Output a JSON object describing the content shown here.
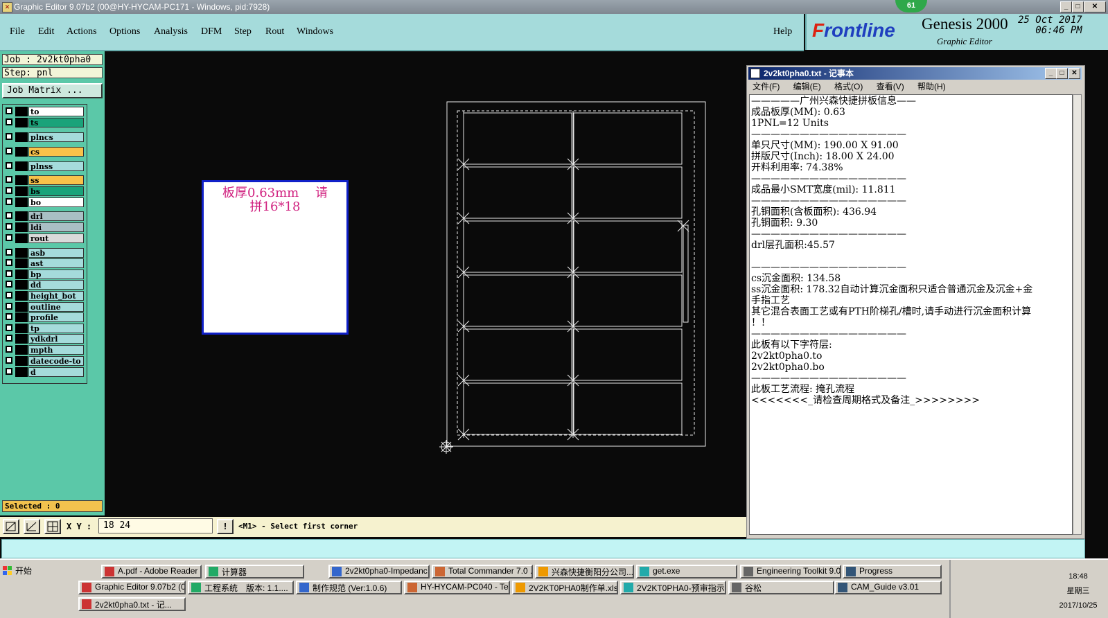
{
  "window": {
    "title": "Graphic Editor 9.07b2 (00@HY-HYCAM-PC171 - Windows, pid:7928)",
    "badge": "61"
  },
  "menu": [
    "File",
    "Edit",
    "Actions",
    "Options",
    "Analysis",
    "DFM",
    "Step",
    "Rout",
    "Windows"
  ],
  "help": "Help",
  "brand": {
    "logo_a": "F",
    "logo_b": "rontline",
    "product": "Genesis 2000",
    "subtitle": "Graphic Editor",
    "date": "25 Oct 2017",
    "time": "06:46 PM"
  },
  "job": {
    "job_label": "Job : 2v2kt0pha0",
    "step_label": "Step: pnl",
    "matrix_button": "Job Matrix ..."
  },
  "layers": [
    {
      "name": "to",
      "color": "#ffffff"
    },
    {
      "name": "ts",
      "color": "#1aa37a"
    },
    {
      "name": "plncs",
      "color": "#a5dbdb"
    },
    {
      "name": "cs",
      "color": "#f9c24a"
    },
    {
      "name": "plnss",
      "color": "#a5dbdb"
    },
    {
      "name": "ss",
      "color": "#f9c24a"
    },
    {
      "name": "bs",
      "color": "#1aa37a"
    },
    {
      "name": "bo",
      "color": "#ffffff"
    },
    {
      "name": "drl",
      "color": "#a9bfc4"
    },
    {
      "name": "ldi",
      "color": "#a9bfc4"
    },
    {
      "name": "rout",
      "color": "#dadada"
    },
    {
      "name": "asb",
      "color": "#a5dbdb"
    },
    {
      "name": "ast",
      "color": "#a5dbdb"
    },
    {
      "name": "bp",
      "color": "#a5dbdb"
    },
    {
      "name": "dd",
      "color": "#a5dbdb"
    },
    {
      "name": "height_bot",
      "color": "#a5dbdb"
    },
    {
      "name": "outline",
      "color": "#a5dbdb"
    },
    {
      "name": "profile",
      "color": "#a5dbdb"
    },
    {
      "name": "tp",
      "color": "#a5dbdb"
    },
    {
      "name": "ydkdrl",
      "color": "#a5dbdb"
    },
    {
      "name": "mpth",
      "color": "#a5dbdb"
    },
    {
      "name": "datecode-to",
      "color": "#a5dbdb"
    },
    {
      "name": "d",
      "color": "#a5dbdb"
    }
  ],
  "selected": "Selected : 0",
  "toolbar": {
    "xy_label": "X Y :",
    "xy_value": "18 24",
    "warn": "!",
    "message": "<M1> - Select first corner"
  },
  "note": {
    "line1": "板厚0.63mm　 请",
    "line2": "拼16*18"
  },
  "notepad": {
    "title": "2v2kt0pha0.txt - 记事本",
    "menu": [
      "文件(F)",
      "编辑(E)",
      "格式(O)",
      "查看(V)",
      "帮助(H)"
    ],
    "lines": [
      "—————广州兴森快捷拼板信息——",
      "成品板厚(MM): 0.63",
      "1PNL=12 Units",
      "————————————————",
      "单只尺寸(MM): 190.00 X 91.00",
      "拼版尺寸(Inch): 18.00 X 24.00",
      "开料利用率: 74.38%",
      "————————————————",
      "成品最小SMT宽度(mil): 11.811",
      "————————————————",
      "孔铜面积(含板面积): 436.94",
      "孔铜面积: 9.30",
      "————————————————",
      "drl层孔面积:45.57",
      "",
      "————————————————",
      "cs沉金面积: 134.58",
      "ss沉金面积: 178.32自动计算沉金面积只适合普通沉金及沉金+金",
      "手指工艺",
      "其它混合表面工艺或有PTH阶梯孔/槽时,请手动进行沉金面积计算",
      "！！",
      "————————————————",
      "此板有以下字符层:",
      "2v2kt0pha0.to",
      "2v2kt0pha0.bo",
      "————————————————",
      "此板工艺流程: 掩孔流程",
      "<<<<<<<_请检查周期格式及备注_>>>>>>>>"
    ]
  },
  "taskbar": {
    "start": "开始",
    "row1": [
      "A.pdf - Adobe Reader",
      "计算器",
      "2v2kt0pha0-Impedanc...",
      "Total Commander 7.0 ...",
      "兴森快捷衡阳分公司...",
      "get.exe",
      "Engineering Toolkit 9.0...",
      "Progress"
    ],
    "row2": [
      "Graphic Editor 9.07b2 (0...",
      "工程系统　版本: 1.1....",
      "制作规范 (Ver:1.0.6)",
      "HY-HYCAM-PC040 - Tea...",
      "2V2KT0PHA0制作单.xls...",
      "2V2KT0PHA0-预审指示...",
      "谷松",
      "CAM_Guide v3.01"
    ],
    "row3": [
      "2v2kt0pha0.txt - 记..."
    ],
    "clock_time": "18:48",
    "clock_day": "星期三",
    "clock_date": "2017/10/25"
  }
}
